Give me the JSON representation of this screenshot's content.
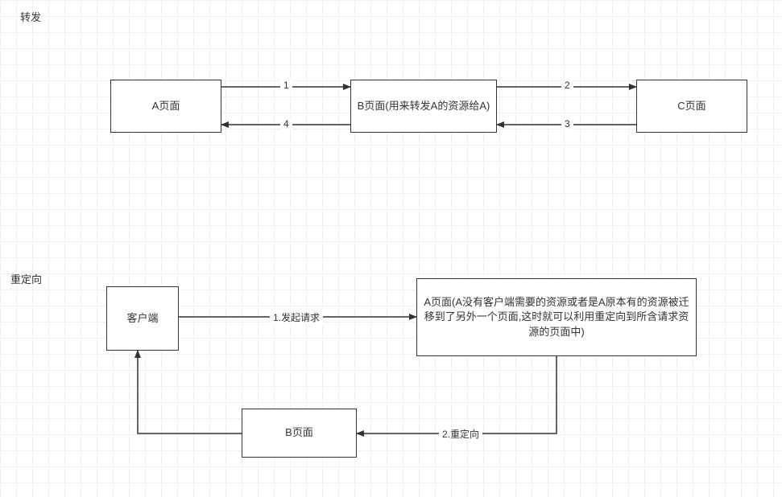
{
  "section1": {
    "title": "转发",
    "nodes": {
      "a": "A页面",
      "b": "B页面(用来转发A的资源给A)",
      "c": "C页面"
    },
    "edges": {
      "e1": "1",
      "e2": "2",
      "e3": "3",
      "e4": "4"
    }
  },
  "section2": {
    "title": "重定向",
    "nodes": {
      "client": "客户端",
      "a": "A页面(A没有客户端需要的资源或者是A原本有的资源被迁移到了另外一个页面,这时就可以利用重定向到所含请求资源的页面中)",
      "b": "B页面"
    },
    "edges": {
      "e1": "1.发起请求",
      "e2": "2.重定向"
    }
  }
}
